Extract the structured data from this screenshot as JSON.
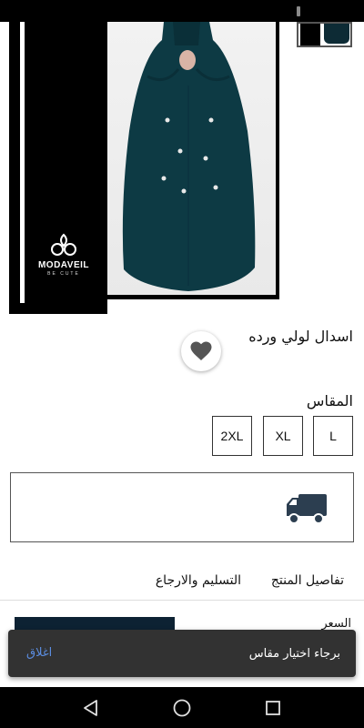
{
  "product": {
    "title": "اسدال لولي ورده",
    "brand_name": "MODAVEIL",
    "brand_tagline": "BE CUTE"
  },
  "size": {
    "label": "المقاس",
    "options": [
      "L",
      "XL",
      "2XL"
    ]
  },
  "tabs": {
    "details": "تفاصيل المنتج",
    "delivery": "التسليم والارجاع"
  },
  "price": {
    "label": "السعر"
  },
  "snackbar": {
    "message": "برجاء اختيار مقاس",
    "action": "اغلاق"
  },
  "colors": {
    "garment": "#0d3a44",
    "button": "#0d2233",
    "snackbar_bg": "#323232",
    "snackbar_action": "#5b8de0",
    "truck": "#2c3e50"
  },
  "icons": {
    "favorite": "heart-icon",
    "delivery": "truck-icon",
    "back": "back-triangle-icon",
    "home": "home-circle-icon",
    "recent": "recent-square-icon"
  }
}
